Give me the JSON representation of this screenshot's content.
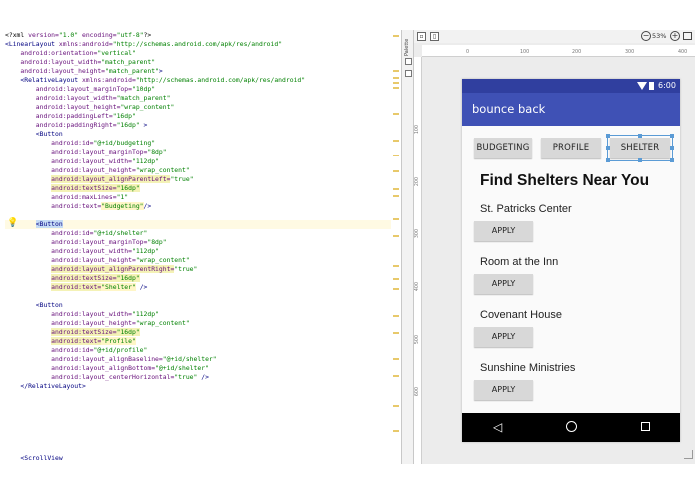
{
  "editor": {
    "lines": [
      [
        {
          "t": "<?xml ",
          "c": "pun"
        },
        {
          "t": "version=",
          "c": "attr"
        },
        {
          "t": "\"1.0\" ",
          "c": "val"
        },
        {
          "t": "encoding=",
          "c": "attr"
        },
        {
          "t": "\"utf-8\"",
          "c": "val"
        },
        {
          "t": "?>",
          "c": "pun"
        }
      ],
      [
        {
          "t": "<LinearLayout ",
          "c": "tag"
        },
        {
          "t": "xmlns:android=",
          "c": "attr"
        },
        {
          "t": "\"http://schemas.android.com/apk/res/android\"",
          "c": "val"
        }
      ],
      [
        {
          "t": "    android:orientation=",
          "c": "attr"
        },
        {
          "t": "\"vertical\"",
          "c": "val"
        }
      ],
      [
        {
          "t": "    android:layout_width=",
          "c": "attr"
        },
        {
          "t": "\"match_parent\"",
          "c": "val"
        }
      ],
      [
        {
          "t": "    android:layout_height=",
          "c": "attr"
        },
        {
          "t": "\"match_parent\"",
          "c": "val"
        },
        {
          "t": ">",
          "c": "tag"
        }
      ],
      [
        {
          "t": "    <RelativeLayout ",
          "c": "tag"
        },
        {
          "t": "xmlns:android=",
          "c": "attr"
        },
        {
          "t": "\"http://schemas.android.com/apk/res/android\"",
          "c": "val"
        }
      ],
      [
        {
          "t": "        android:layout_marginTop=",
          "c": "attr"
        },
        {
          "t": "\"10dp\"",
          "c": "val"
        }
      ],
      [
        {
          "t": "        android:layout_width=",
          "c": "attr"
        },
        {
          "t": "\"match_parent\"",
          "c": "val"
        }
      ],
      [
        {
          "t": "        android:layout_height=",
          "c": "attr"
        },
        {
          "t": "\"wrap_content\"",
          "c": "val"
        }
      ],
      [
        {
          "t": "        android:paddingLeft=",
          "c": "attr"
        },
        {
          "t": "\"16dp\"",
          "c": "val"
        }
      ],
      [
        {
          "t": "        android:paddingRight=",
          "c": "attr"
        },
        {
          "t": "\"16dp\"",
          "c": "val"
        },
        {
          "t": " >",
          "c": "tag"
        }
      ],
      [
        {
          "t": "        <Button",
          "c": "tag"
        }
      ],
      [
        {
          "t": "            android:id=",
          "c": "attr"
        },
        {
          "t": "\"@+id/budgeting\"",
          "c": "val"
        }
      ],
      [
        {
          "t": "            android:layout_marginTop=",
          "c": "attr"
        },
        {
          "t": "\"8dp\"",
          "c": "val"
        }
      ],
      [
        {
          "t": "            android:layout_width=",
          "c": "attr"
        },
        {
          "t": "\"112dp\"",
          "c": "val"
        }
      ],
      [
        {
          "t": "            android:layout_height=",
          "c": "attr"
        },
        {
          "t": "\"wrap_content\"",
          "c": "val"
        }
      ],
      [
        {
          "t": "            ",
          "c": "pun"
        },
        {
          "t": "android:layout_alignParentLeft=",
          "c": "attr",
          "h": "y"
        },
        {
          "t": "\"true\"",
          "c": "val"
        }
      ],
      [
        {
          "t": "            ",
          "c": "pun"
        },
        {
          "t": "android:textSize=",
          "c": "attr",
          "h": "y"
        },
        {
          "t": "\"16dp\"",
          "c": "val",
          "h": "y"
        }
      ],
      [
        {
          "t": "            android:maxLines=",
          "c": "attr"
        },
        {
          "t": "\"1\"",
          "c": "val"
        }
      ],
      [
        {
          "t": "            android:text=",
          "c": "attr"
        },
        {
          "t": "\"Budgeting\"",
          "c": "val",
          "h": "w"
        },
        {
          "t": "/>",
          "c": "tag"
        }
      ],
      [],
      [
        {
          "t": "        ",
          "c": "pun"
        },
        {
          "t": "<Button",
          "c": "tag",
          "h": "caret"
        }
      ],
      [
        {
          "t": "            android:id=",
          "c": "attr"
        },
        {
          "t": "\"@+id/shelter\"",
          "c": "val"
        }
      ],
      [
        {
          "t": "            android:layout_marginTop=",
          "c": "attr"
        },
        {
          "t": "\"8dp\"",
          "c": "val"
        }
      ],
      [
        {
          "t": "            android:layout_width=",
          "c": "attr"
        },
        {
          "t": "\"112dp\"",
          "c": "val"
        }
      ],
      [
        {
          "t": "            android:layout_height=",
          "c": "attr"
        },
        {
          "t": "\"wrap_content\"",
          "c": "val"
        }
      ],
      [
        {
          "t": "            ",
          "c": "pun"
        },
        {
          "t": "android:layout_alignParentRight=",
          "c": "attr",
          "h": "y"
        },
        {
          "t": "\"true\"",
          "c": "val"
        }
      ],
      [
        {
          "t": "            ",
          "c": "pun"
        },
        {
          "t": "android:textSize=",
          "c": "attr",
          "h": "y"
        },
        {
          "t": "\"16dp\"",
          "c": "val",
          "h": "y"
        }
      ],
      [
        {
          "t": "            ",
          "c": "pun"
        },
        {
          "t": "android:text=",
          "c": "attr",
          "h": "y"
        },
        {
          "t": "\"Shelter\"",
          "c": "val",
          "h": "w"
        },
        {
          "t": " />",
          "c": "tag"
        }
      ],
      [],
      [
        {
          "t": "        <Button",
          "c": "tag"
        }
      ],
      [
        {
          "t": "            android:layout_width=",
          "c": "attr"
        },
        {
          "t": "\"112dp\"",
          "c": "val"
        }
      ],
      [
        {
          "t": "            android:layout_height=",
          "c": "attr"
        },
        {
          "t": "\"wrap_content\"",
          "c": "val"
        }
      ],
      [
        {
          "t": "            ",
          "c": "pun"
        },
        {
          "t": "android:textSize=",
          "c": "attr",
          "h": "y"
        },
        {
          "t": "\"16dp\"",
          "c": "val",
          "h": "y"
        }
      ],
      [
        {
          "t": "            ",
          "c": "pun"
        },
        {
          "t": "android:text=",
          "c": "attr",
          "h": "y"
        },
        {
          "t": "\"Profile\"",
          "c": "val",
          "h": "w"
        }
      ],
      [
        {
          "t": "            android:id=",
          "c": "attr"
        },
        {
          "t": "\"@+id/profile\"",
          "c": "val"
        }
      ],
      [
        {
          "t": "            android:layout_alignBaseline=",
          "c": "attr"
        },
        {
          "t": "\"@+id/shelter\"",
          "c": "val"
        }
      ],
      [
        {
          "t": "            android:layout_alignBottom=",
          "c": "attr"
        },
        {
          "t": "\"@+id/shelter\"",
          "c": "val"
        }
      ],
      [
        {
          "t": "            android:layout_centerHorizontal=",
          "c": "attr"
        },
        {
          "t": "\"true\"",
          "c": "val"
        },
        {
          "t": " />",
          "c": "tag"
        }
      ],
      [
        {
          "t": "    </RelativeLayout>",
          "c": "tag"
        }
      ],
      [],
      [],
      [],
      [],
      [],
      [],
      [],
      [
        {
          "t": "    <ScrollView",
          "c": "tag"
        }
      ],
      [
        {
          "t": "        android:id=",
          "c": "attr"
        },
        {
          "t": "\"@+id/login_form\"",
          "c": "val"
        }
      ],
      [
        {
          "t": "        android:layout_width=",
          "c": "attr"
        },
        {
          "t": "\"match_parent\"",
          "c": "val"
        }
      ]
    ],
    "current_line": 21
  },
  "tool_strip": {
    "label": "Palette"
  },
  "preview": {
    "zoom_level": "53%",
    "zoom_out": "−",
    "zoom_in": "+",
    "ruler_ticks": [
      "0",
      "100",
      "200",
      "300",
      "400"
    ],
    "vruler_ticks": [
      "100",
      "200",
      "300",
      "400",
      "500",
      "600"
    ]
  },
  "device": {
    "status_time": "6:00",
    "app_title": "bounce back",
    "buttons": {
      "budgeting": "BUDGETING",
      "profile": "PROFILE",
      "shelter": "SHELTER"
    },
    "heading": "Find Shelters Near You",
    "shelters": [
      {
        "name": "St. Patricks Center",
        "apply": "APPLY"
      },
      {
        "name": "Room at the Inn",
        "apply": "APPLY"
      },
      {
        "name": "Covenant House",
        "apply": "APPLY"
      },
      {
        "name": "Sunshine Ministries",
        "apply": "APPLY"
      }
    ],
    "nav": {
      "back": "◁"
    }
  },
  "colors": {
    "status_bar": "#303f9f",
    "app_bar": "#3f51b5",
    "selection": "#5b9bd5",
    "highlight": "#f4f2b6"
  }
}
